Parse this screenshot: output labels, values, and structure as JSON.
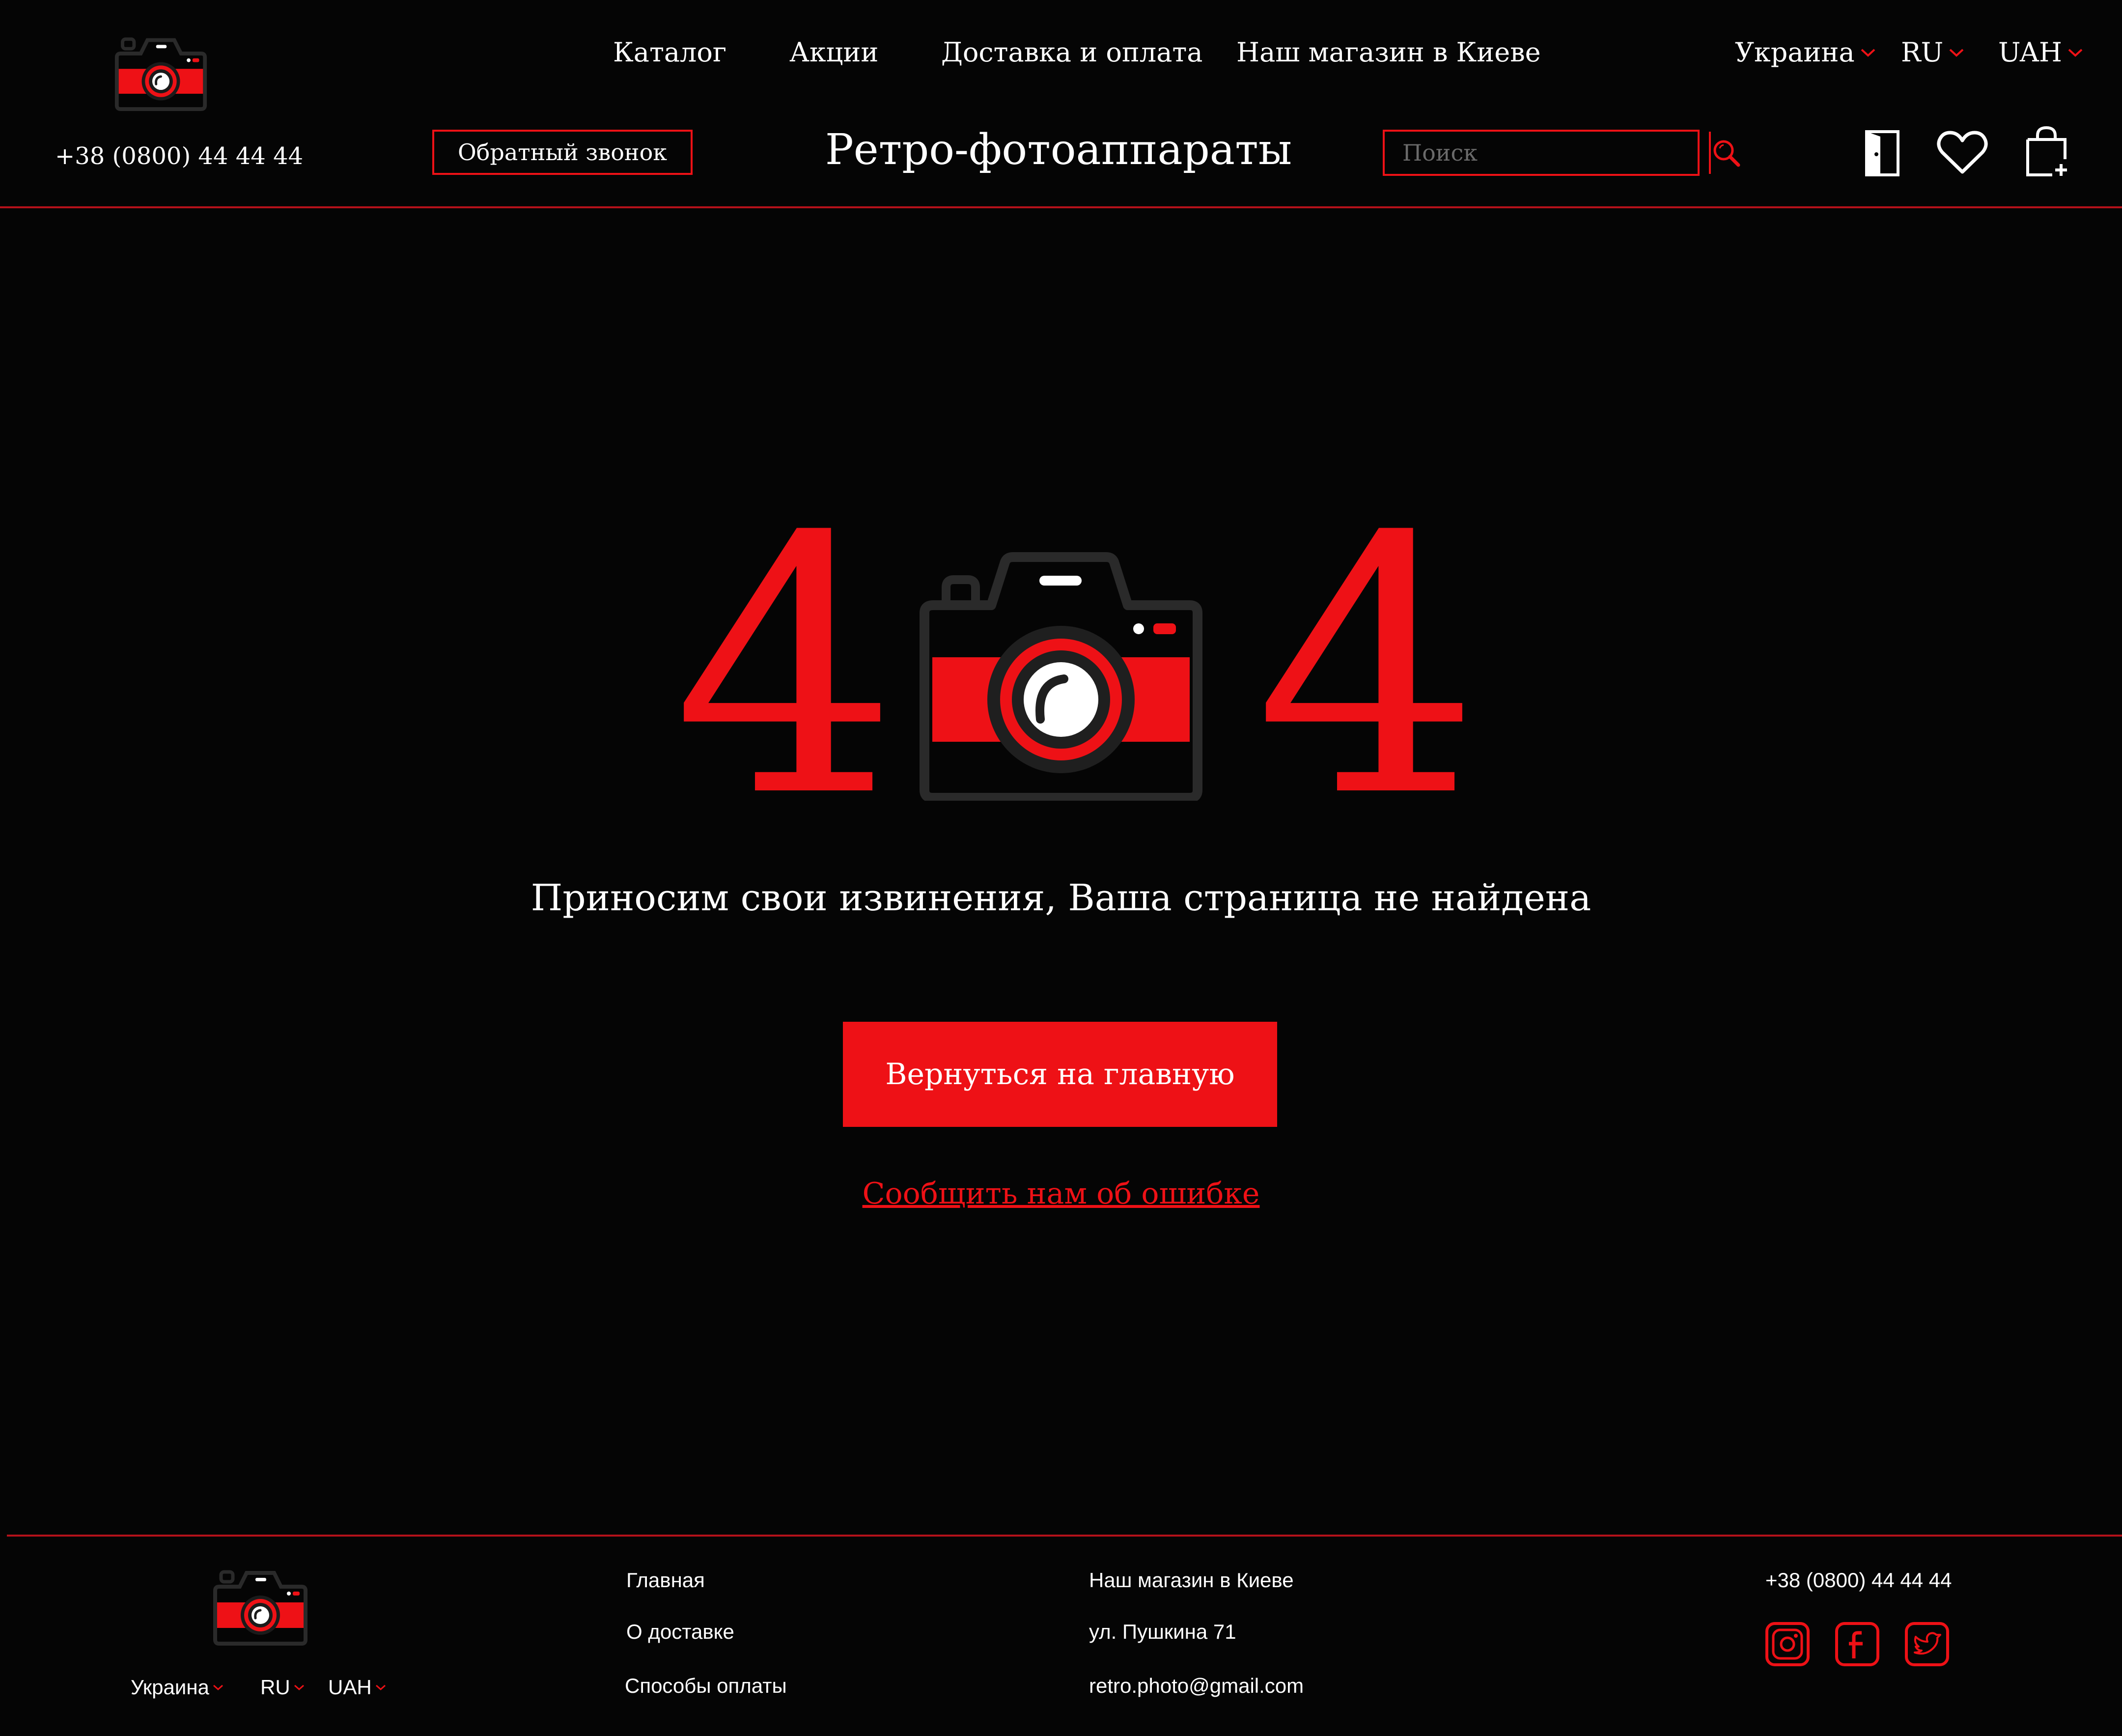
{
  "header": {
    "nav": [
      "Каталог",
      "Акции",
      "Доставка и оплата",
      "Наш магазин в Киеве"
    ],
    "country": "Украина",
    "language": "RU",
    "currency": "UAH",
    "phone": "+38 (0800) 44 44 44",
    "callback_label": "Обратный звонок",
    "site_title": "Ретро-фотоаппараты",
    "search_placeholder": "Поиск"
  },
  "icons": {
    "logo": "camera-logo-icon",
    "search": "search-icon",
    "login": "door-icon",
    "wishlist": "heart-icon",
    "cart": "shopping-bag-icon",
    "instagram": "instagram-icon",
    "facebook": "facebook-icon",
    "twitter": "twitter-icon"
  },
  "main": {
    "digit_left": "4",
    "digit_right": "4",
    "apology": "Приносим свои извинения, Ваша страница не найдена",
    "home_button": "Вернуться на главную",
    "report_link": "Сообщить нам об ошибке"
  },
  "footer": {
    "country": "Украина",
    "language": "RU",
    "currency": "UAH",
    "links": [
      "Главная",
      "О доставке",
      "Способы оплаты"
    ],
    "store": "Наш магазин в Киеве",
    "address": "ул. Пушкина 71",
    "email": "retro.photo@gmail.com",
    "phone": "+38 (0800) 44 44 44"
  },
  "colors": {
    "background": "#050505",
    "accent": "#ee1116",
    "text": "#ffffff",
    "camera_body": "#2a2a2a"
  }
}
